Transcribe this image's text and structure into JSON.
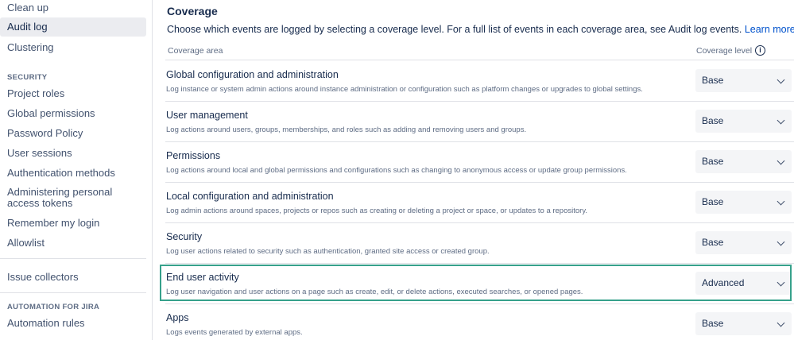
{
  "sidebar": {
    "items_top": [
      "Clean up",
      "Audit log",
      "Clustering"
    ],
    "security_heading": "SECURITY",
    "security_items": [
      "Project roles",
      "Global permissions",
      "Password Policy",
      "User sessions",
      "Authentication methods",
      "Administering personal access tokens",
      "Remember my login",
      "Allowlist"
    ],
    "issue_collectors": "Issue collectors",
    "automation_heading": "AUTOMATION FOR JIRA",
    "automation_rules": "Automation rules",
    "selected_item": "Audit log"
  },
  "main": {
    "title": "Coverage",
    "intro": "Choose which events are logged by selecting a coverage level. For a full list of events in each coverage area, see Audit log events.",
    "learn_more": "Learn more",
    "col_area": "Coverage area",
    "col_level": "Coverage level",
    "info_icon": "info-icon",
    "rows": [
      {
        "title": "Global configuration and administration",
        "desc": "Log instance or system admin actions around instance administration or configuration such as platform changes or upgrades to global settings.",
        "level": "Base"
      },
      {
        "title": "User management",
        "desc": "Log actions around users, groups, memberships, and roles such as adding and removing users and groups.",
        "level": "Base"
      },
      {
        "title": "Permissions",
        "desc": "Log actions around local and global permissions and configurations such as changing to anonymous access or update group permissions.",
        "level": "Base"
      },
      {
        "title": "Local configuration and administration",
        "desc": "Log admin actions around spaces, projects or repos such as creating or deleting a project or space, or updates to a repository.",
        "level": "Base"
      },
      {
        "title": "Security",
        "desc": "Log user actions related to security such as authentication, granted site access or created group.",
        "level": "Base"
      },
      {
        "title": "End user activity",
        "desc": "Log user navigation and user actions on a page such as create, edit, or delete actions, executed searches, or opened pages.",
        "level": "Advanced"
      },
      {
        "title": "Apps",
        "desc": "Logs events generated by external apps.",
        "level": "Base"
      }
    ],
    "highlight_color": "#36a18b"
  }
}
